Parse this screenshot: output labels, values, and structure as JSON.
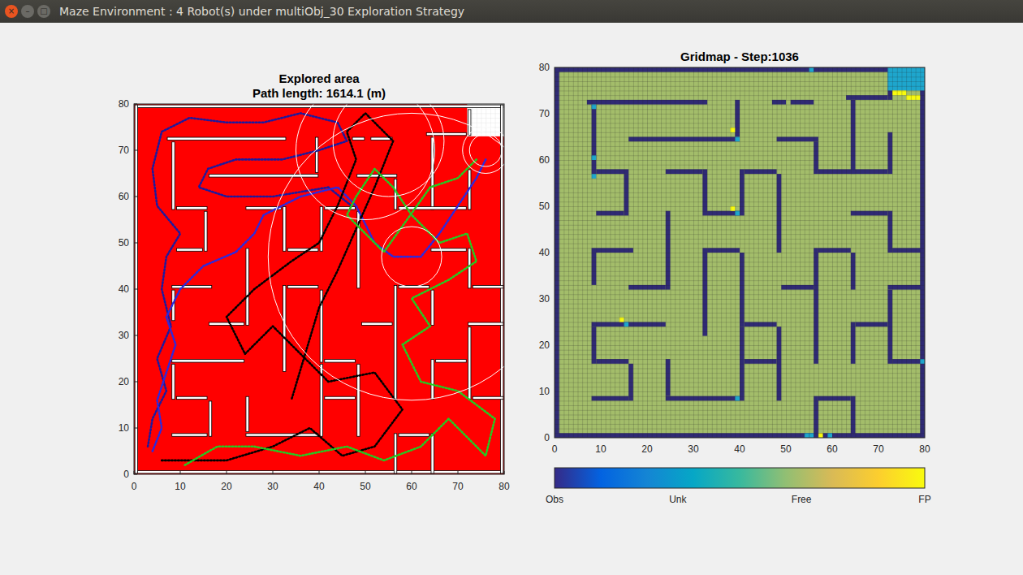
{
  "window": {
    "title": "Maze Environment : 4 Robot(s) under multiObj_30 Exploration Strategy",
    "controls": [
      {
        "label": "×",
        "kind": "close"
      },
      {
        "label": "–",
        "kind": "minimize"
      },
      {
        "label": "□",
        "kind": "maximize"
      }
    ]
  },
  "maze": {
    "size": 80,
    "walls": [
      [
        0,
        0,
        79,
        0
      ],
      [
        0,
        79,
        79,
        79
      ],
      [
        0,
        0,
        0,
        79
      ],
      [
        79,
        0,
        79,
        79
      ],
      [
        7,
        72,
        32,
        72
      ],
      [
        47,
        72,
        49,
        72
      ],
      [
        51,
        72,
        55,
        72
      ],
      [
        63,
        73,
        71,
        73
      ],
      [
        72,
        73,
        72,
        78
      ],
      [
        39,
        65,
        39,
        72
      ],
      [
        8,
        57,
        8,
        71
      ],
      [
        16,
        64,
        39,
        64
      ],
      [
        48,
        64,
        56,
        64
      ],
      [
        56,
        57,
        56,
        63
      ],
      [
        64,
        57,
        64,
        72
      ],
      [
        57,
        57,
        71,
        57
      ],
      [
        72,
        57,
        72,
        65
      ],
      [
        9,
        57,
        15,
        57
      ],
      [
        15,
        48,
        15,
        56
      ],
      [
        9,
        48,
        14,
        48
      ],
      [
        24,
        57,
        31,
        57
      ],
      [
        32,
        48,
        32,
        57
      ],
      [
        33,
        48,
        39,
        48
      ],
      [
        40,
        48,
        40,
        57
      ],
      [
        41,
        57,
        47,
        57
      ],
      [
        48,
        40,
        48,
        56
      ],
      [
        64,
        48,
        71,
        48
      ],
      [
        72,
        40,
        72,
        48
      ],
      [
        73,
        40,
        79,
        40
      ],
      [
        8,
        40,
        16,
        40
      ],
      [
        8,
        33,
        8,
        39
      ],
      [
        16,
        32,
        23,
        32
      ],
      [
        24,
        32,
        24,
        48
      ],
      [
        32,
        22,
        32,
        40
      ],
      [
        33,
        40,
        39,
        40
      ],
      [
        40,
        24,
        40,
        39
      ],
      [
        41,
        24,
        47,
        24
      ],
      [
        49,
        32,
        55,
        32
      ],
      [
        56,
        16,
        56,
        40
      ],
      [
        57,
        40,
        63,
        40
      ],
      [
        64,
        32,
        64,
        39
      ],
      [
        72,
        32,
        79,
        32
      ],
      [
        72,
        16,
        72,
        31
      ],
      [
        8,
        24,
        23,
        24
      ],
      [
        8,
        16,
        8,
        23
      ],
      [
        9,
        16,
        15,
        16
      ],
      [
        16,
        8,
        16,
        15
      ],
      [
        8,
        8,
        15,
        8
      ],
      [
        24,
        8,
        39,
        8
      ],
      [
        24,
        9,
        24,
        16
      ],
      [
        40,
        8,
        40,
        23
      ],
      [
        41,
        16,
        47,
        16
      ],
      [
        48,
        8,
        48,
        23
      ],
      [
        56,
        0,
        56,
        8
      ],
      [
        64,
        0,
        64,
        8
      ],
      [
        64,
        16,
        64,
        24
      ],
      [
        65,
        24,
        71,
        24
      ],
      [
        73,
        16,
        79,
        16
      ],
      [
        57,
        8,
        63,
        8
      ]
    ]
  },
  "left_plot": {
    "title": "Explored area",
    "subtitle": "Path length: 1614.1 (m)",
    "x_ticks": [
      "0",
      "10",
      "20",
      "30",
      "40",
      "50",
      "60",
      "70",
      "80"
    ],
    "y_ticks": [
      "0",
      "10",
      "20",
      "30",
      "40",
      "50",
      "60",
      "70",
      "80"
    ],
    "unexplored_area": [
      72,
      73,
      80,
      80
    ],
    "robots": [
      {
        "color": "#1a1aa0",
        "points": [
          [
            3,
            6
          ],
          [
            4,
            12
          ],
          [
            7,
            18
          ],
          [
            5,
            25
          ],
          [
            8,
            32
          ],
          [
            6,
            40
          ],
          [
            7,
            47
          ],
          [
            10,
            52
          ],
          [
            5,
            58
          ],
          [
            4,
            66
          ],
          [
            6,
            74
          ],
          [
            12,
            77
          ],
          [
            20,
            76
          ],
          [
            28,
            76
          ],
          [
            36,
            78
          ],
          [
            44,
            76
          ],
          [
            46,
            72
          ],
          [
            40,
            70
          ],
          [
            32,
            68
          ],
          [
            22,
            68
          ],
          [
            16,
            66
          ],
          [
            14,
            62
          ],
          [
            20,
            60
          ],
          [
            30,
            60
          ],
          [
            42,
            62
          ],
          [
            47,
            58
          ]
        ]
      },
      {
        "color": "#2a2ae0",
        "points": [
          [
            4,
            5
          ],
          [
            6,
            10
          ],
          [
            5,
            16
          ],
          [
            7,
            22
          ],
          [
            9,
            28
          ],
          [
            7,
            34
          ],
          [
            10,
            40
          ],
          [
            15,
            45
          ],
          [
            22,
            48
          ],
          [
            26,
            52
          ],
          [
            28,
            56
          ],
          [
            36,
            60
          ],
          [
            44,
            62
          ],
          [
            48,
            58
          ],
          [
            50,
            54
          ],
          [
            52,
            50
          ],
          [
            56,
            47
          ],
          [
            62,
            47
          ],
          [
            66,
            52
          ],
          [
            70,
            58
          ],
          [
            74,
            64
          ],
          [
            76,
            68
          ]
        ]
      },
      {
        "color": "#000000",
        "points": [
          [
            6,
            3
          ],
          [
            12,
            3
          ],
          [
            20,
            3
          ],
          [
            30,
            6
          ],
          [
            38,
            10
          ],
          [
            45,
            4
          ],
          [
            52,
            6
          ],
          [
            58,
            14
          ],
          [
            52,
            22
          ],
          [
            42,
            20
          ],
          [
            36,
            26
          ],
          [
            30,
            32
          ],
          [
            24,
            26
          ],
          [
            20,
            34
          ],
          [
            26,
            40
          ],
          [
            34,
            46
          ],
          [
            40,
            50
          ],
          [
            44,
            58
          ],
          [
            48,
            68
          ],
          [
            46,
            74
          ],
          [
            50,
            78
          ],
          [
            56,
            72
          ],
          [
            52,
            62
          ],
          [
            44,
            44
          ],
          [
            40,
            36
          ],
          [
            34,
            16
          ]
        ]
      },
      {
        "color": "#22cc22",
        "points": [
          [
            11,
            2
          ],
          [
            18,
            6
          ],
          [
            26,
            6
          ],
          [
            36,
            4
          ],
          [
            46,
            6
          ],
          [
            54,
            3
          ],
          [
            62,
            6
          ],
          [
            68,
            12
          ],
          [
            76,
            4
          ],
          [
            78,
            12
          ],
          [
            70,
            18
          ],
          [
            62,
            20
          ],
          [
            58,
            28
          ],
          [
            64,
            32
          ],
          [
            60,
            38
          ],
          [
            68,
            42
          ],
          [
            74,
            46
          ],
          [
            72,
            52
          ],
          [
            66,
            50
          ],
          [
            60,
            56
          ],
          [
            56,
            62
          ],
          [
            52,
            66
          ],
          [
            48,
            60
          ],
          [
            46,
            56
          ],
          [
            54,
            48
          ],
          [
            64,
            62
          ],
          [
            70,
            64
          ],
          [
            74,
            68
          ]
        ]
      }
    ],
    "sensor_circles": [
      [
        60,
        47,
        31
      ],
      [
        60,
        47,
        6.5
      ],
      [
        76,
        70,
        5
      ],
      [
        76,
        70,
        3.5
      ],
      [
        55,
        72,
        12
      ],
      [
        50,
        70,
        15
      ]
    ]
  },
  "right_plot": {
    "title": "Gridmap - Step:1036",
    "x_ticks": [
      "0",
      "10",
      "20",
      "30",
      "40",
      "50",
      "60",
      "70",
      "80"
    ],
    "y_ticks": [
      "0",
      "10",
      "20",
      "30",
      "40",
      "50",
      "60",
      "70",
      "80"
    ],
    "unknown_block": [
      72,
      75,
      79,
      79
    ],
    "unknown_cells": [
      [
        8,
        71
      ],
      [
        39,
        64
      ],
      [
        8,
        56
      ],
      [
        39,
        48
      ],
      [
        15,
        24
      ],
      [
        39,
        8
      ],
      [
        54,
        0
      ],
      [
        55,
        0
      ],
      [
        55,
        79
      ],
      [
        79,
        16
      ],
      [
        59,
        0
      ],
      [
        8,
        60
      ]
    ],
    "fp_cells": [
      [
        73,
        74
      ],
      [
        74,
        74
      ],
      [
        75,
        74
      ],
      [
        76,
        73
      ],
      [
        77,
        73
      ],
      [
        78,
        73
      ],
      [
        38,
        66
      ],
      [
        38,
        49
      ],
      [
        14,
        25
      ],
      [
        57,
        0
      ]
    ]
  },
  "colorbar": {
    "labels": [
      {
        "text": "Obs",
        "pos": 0
      },
      {
        "text": "Unk",
        "pos": 0.333
      },
      {
        "text": "Free",
        "pos": 0.667
      },
      {
        "text": "FP",
        "pos": 1
      }
    ]
  }
}
